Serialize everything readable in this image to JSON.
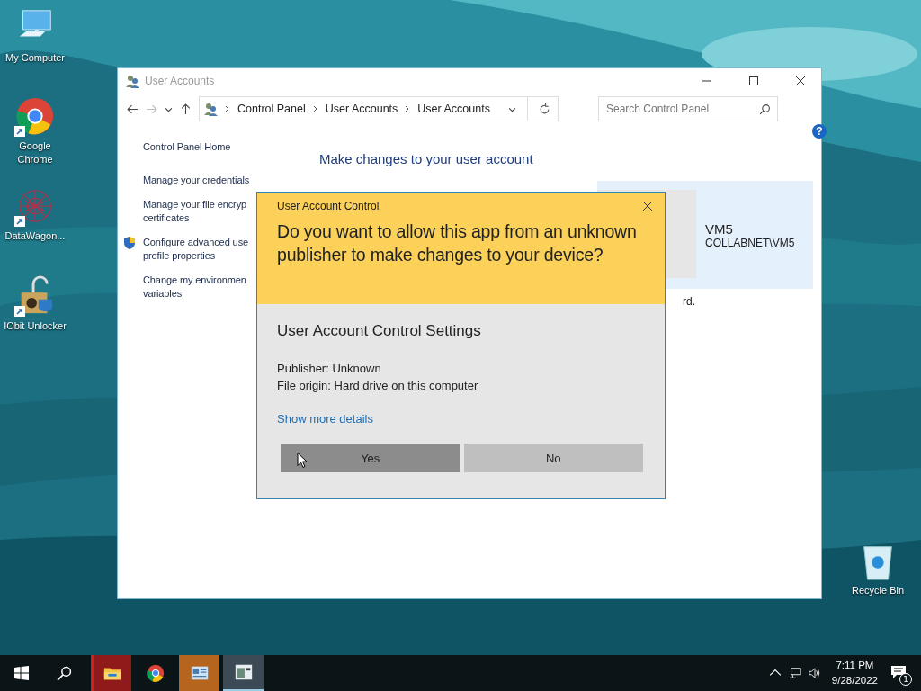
{
  "desktop_icons": [
    {
      "kind": "computer",
      "label": "My Computer",
      "shortcut": false
    },
    {
      "kind": "chrome",
      "label": "Google Chrome",
      "shortcut": true
    },
    {
      "kind": "web",
      "label": "DataWagon...",
      "shortcut": true
    },
    {
      "kind": "unlocker",
      "label": "IObit Unlocker",
      "shortcut": true
    }
  ],
  "recycle_bin": {
    "label": "Recycle Bin"
  },
  "window": {
    "title": "User Accounts",
    "breadcrumb": [
      "Control Panel",
      "User Accounts",
      "User Accounts"
    ],
    "search": {
      "placeholder": "Search Control Panel"
    },
    "help": "?",
    "sidebar": [
      {
        "label": "Control Panel Home",
        "shield": false
      },
      {
        "label": "Manage your credentials",
        "shield": false
      },
      {
        "label": "Manage your file encryp\ncertificates",
        "shield": false
      },
      {
        "label": "Configure advanced use\nprofile properties",
        "shield": true
      },
      {
        "label": "Change my environmen\nvariables",
        "shield": false
      }
    ],
    "heading": "Make changes to your user account",
    "fragment": "rd.",
    "user": {
      "name": "VM5",
      "account": "COLLABNET\\VM5"
    }
  },
  "dialog": {
    "title": "User Account Control",
    "question": "Do you want to allow this app from an unknown publisher to make changes to your device?",
    "program": "User Account Control Settings",
    "publisher": "Publisher: Unknown",
    "origin": "File origin: Hard drive on this computer",
    "details_link": "Show more details",
    "buttons": [
      {
        "label": "Yes",
        "hovered": true
      },
      {
        "label": "No",
        "hovered": false
      }
    ]
  },
  "taskbar": {
    "apps": [
      {
        "kind": "explorer",
        "color": "#8e1a1a"
      },
      {
        "kind": "chrome",
        "color": "#0b1416"
      },
      {
        "kind": "control-panel",
        "color": "#b5651d"
      },
      {
        "kind": "window",
        "color": "#3b4a55"
      }
    ],
    "time": "7:11 PM",
    "date": "9/28/2022",
    "notifications": "1"
  }
}
